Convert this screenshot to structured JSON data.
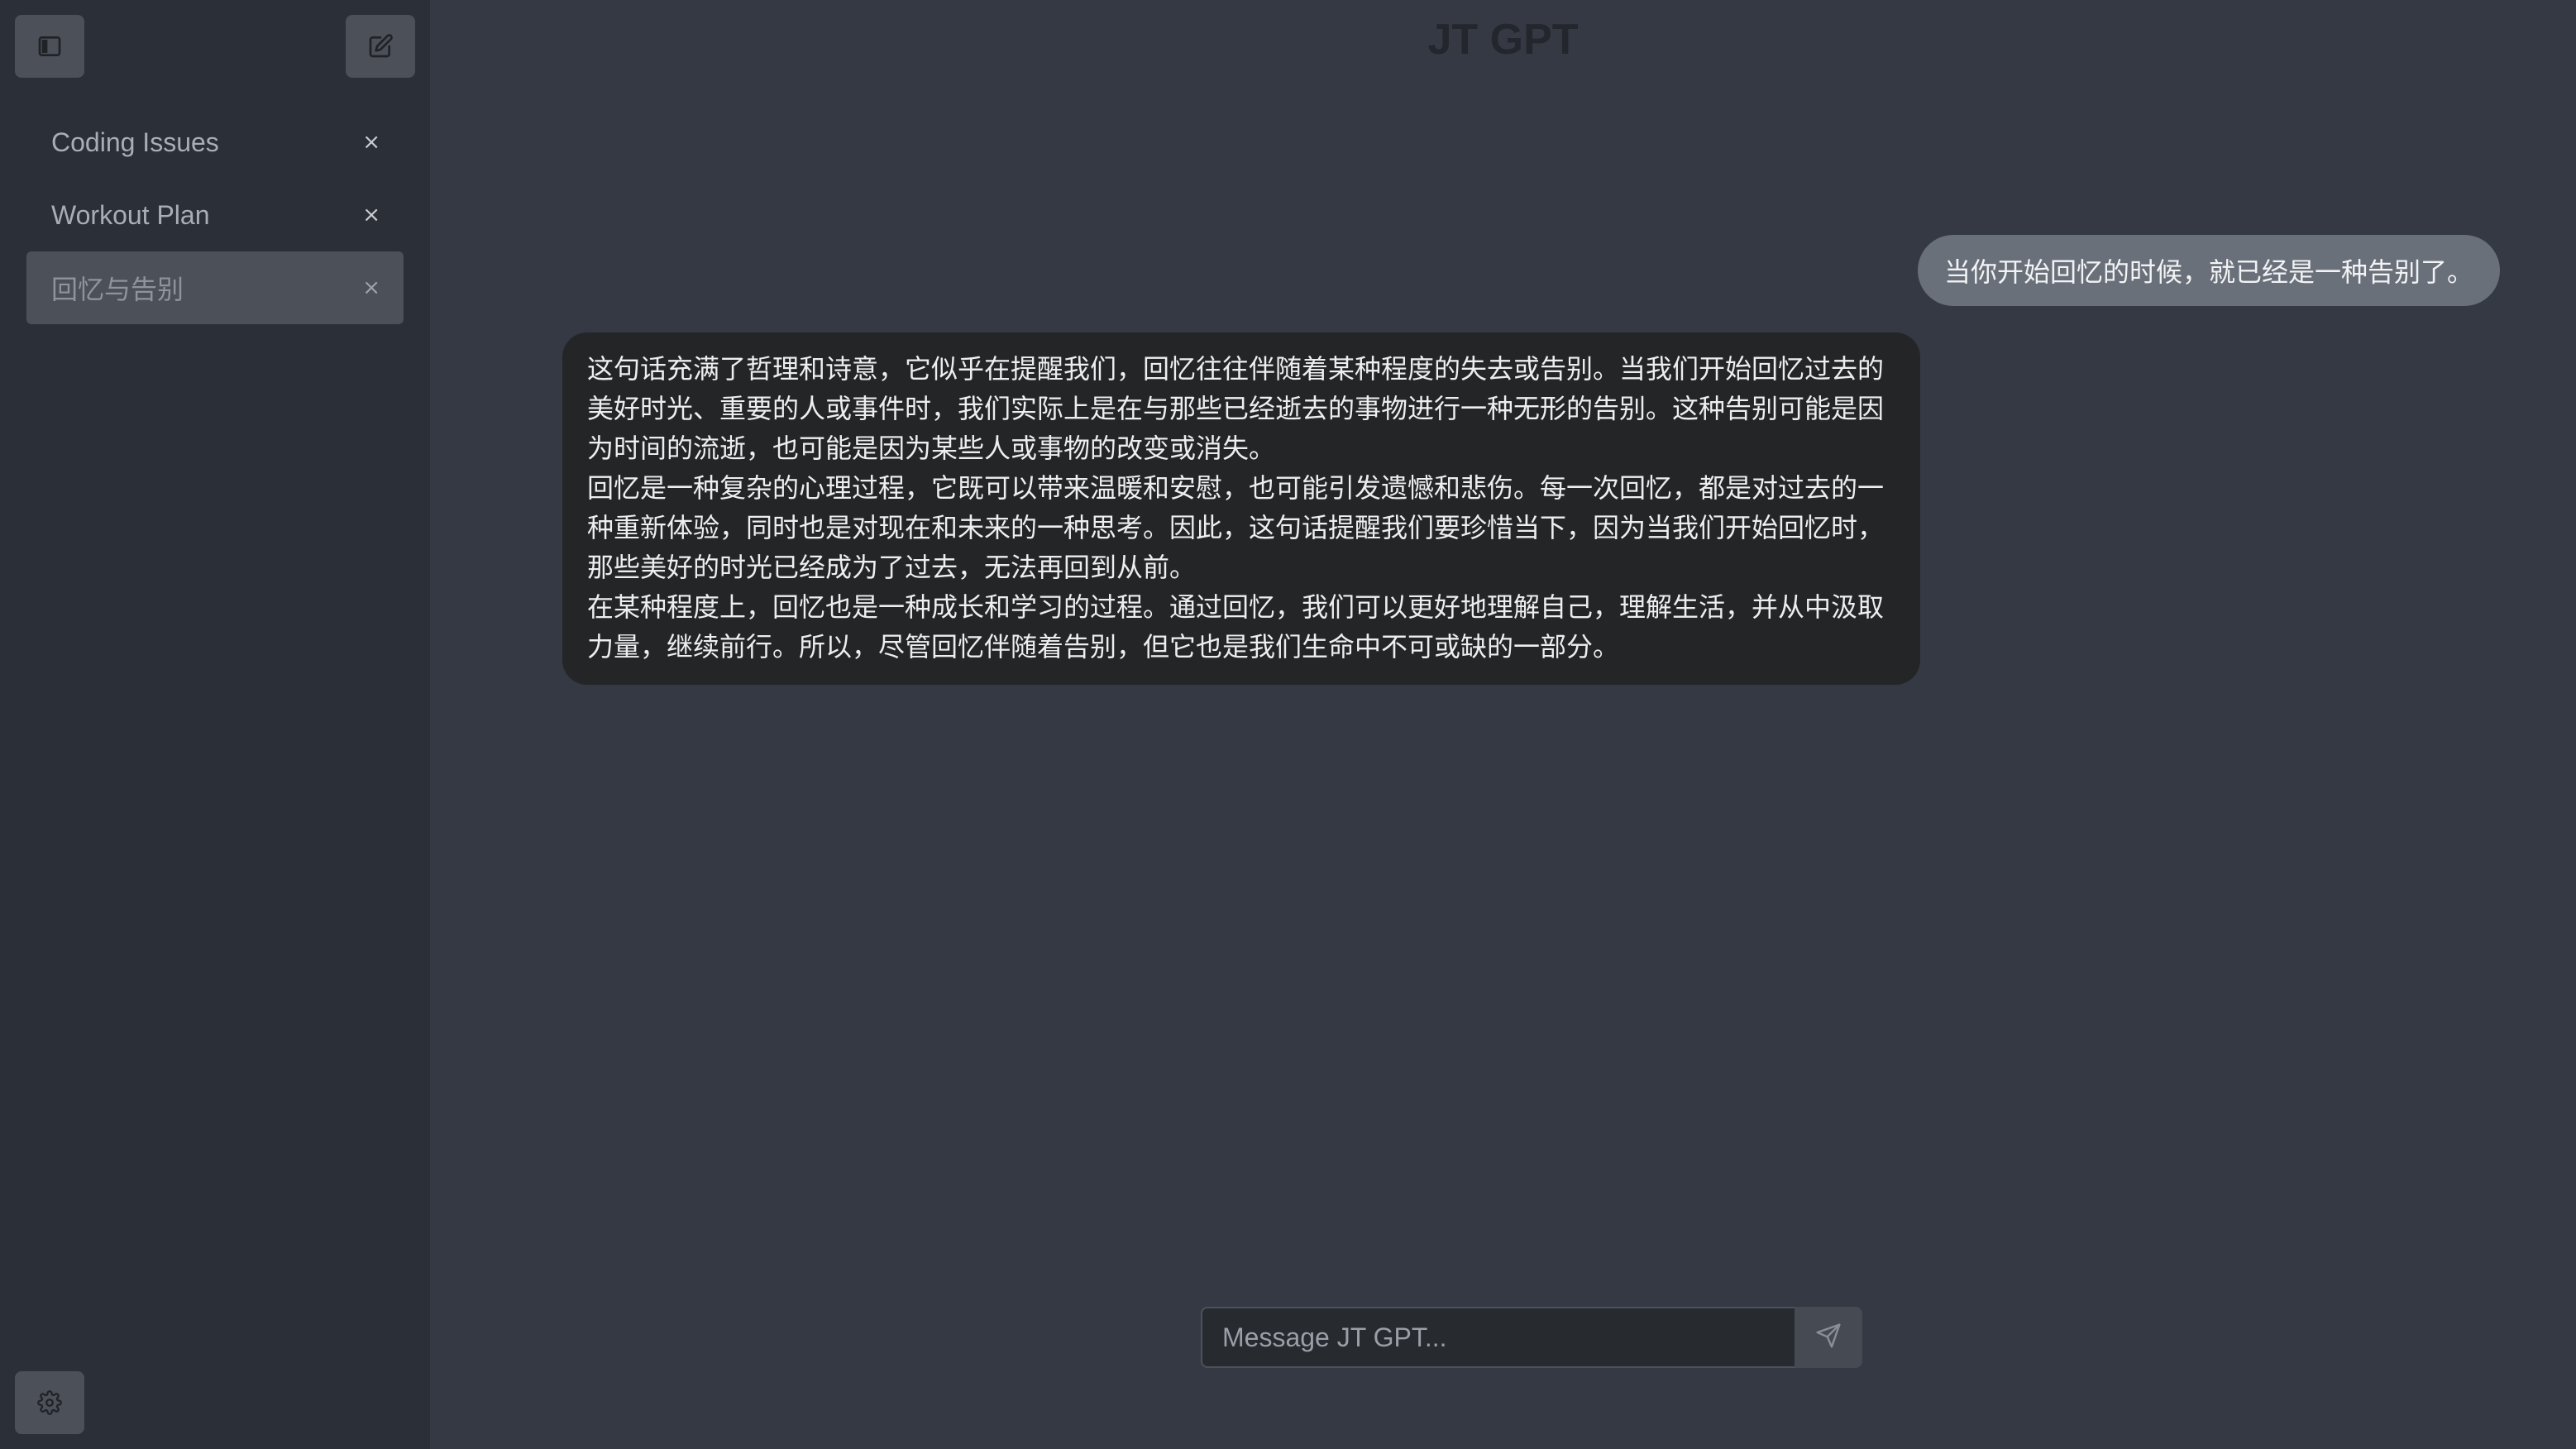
{
  "app": {
    "title": "JT GPT"
  },
  "sidebar": {
    "toggle_icon": "sidebar-panel-icon",
    "new_chat_icon": "edit-icon",
    "settings_icon": "gear-icon",
    "items": [
      {
        "label": "Coding Issues",
        "close": "×"
      },
      {
        "label": "Workout Plan",
        "close": "×"
      },
      {
        "label": "回忆与告别",
        "close": "×"
      }
    ]
  },
  "conversation": {
    "user_message": "当你开始回忆的时候，就已经是一种告别了。",
    "assistant_message": {
      "line1": "这句话充满了哲理和诗意，它似乎在提醒我们，回忆往往伴随着某种程度的失去或告别。当我们开始回忆过去的美好时光、重要的人或事件时，我们实际上是在与那些已经逝去的事物进行一种无形的告别。这种告别可能是因为时间的流逝，也可能是因为某些人或事物的改变或消失。",
      "line2": "回忆是一种复杂的心理过程，它既可以带来温暖和安慰，也可能引发遗憾和悲伤。每一次回忆，都是对过去的一种重新体验，同时也是对现在和未来的一种思考。因此，这句话提醒我们要珍惜当下，因为当我们开始回忆时，那些美好的时光已经成为了过去，无法再回到从前。",
      "line3": "在某种程度上，回忆也是一种成长和学习的过程。通过回忆，我们可以更好地理解自己，理解生活，并从中汲取力量，继续前行。所以，尽管回忆伴随着告别，但它也是我们生命中不可或缺的一部分。"
    }
  },
  "composer": {
    "placeholder": "Message JT GPT...",
    "value": "",
    "send_icon": "send-icon"
  },
  "colors": {
    "main_bg": "#343944",
    "sidebar_bg": "#2b2f37",
    "user_bubble": "#6a707a",
    "assistant_bubble": "#242527"
  }
}
